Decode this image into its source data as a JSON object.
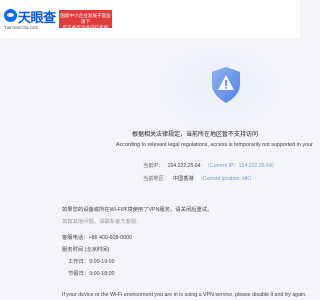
{
  "header": {
    "logo_text": "天眼查",
    "logo_domain": "TianYanCha.com",
    "promo_line_1": "国家中小企业发展子基金旗下",
    "promo_line_2": "官方备案企业征信机构"
  },
  "notice": {
    "title_zh": "根据相关法律规定，当前所在地区暂不支持访问",
    "title_en": "According to relevant legal regulations, access is temporarily not supported in your"
  },
  "ip": {
    "label": "当前IP：",
    "value": "154.222.25.64",
    "en": "（Current IP：154.222.25.64）"
  },
  "region": {
    "label": "当前地区：",
    "value": "中国香港",
    "en": "（Current location: HK）"
  },
  "contact": {
    "vpn_notice": "如果您的设备或所在Wi-Fi环境使用了VPN服务，请关闭后重试。",
    "help_prompt": "如有其他问题，请联系客方客服：",
    "phone_label": "客服电话：",
    "phone": "+86 400-608-0000",
    "hours_label": "服务时间 (北京时间)",
    "workday_label": "工作日：",
    "workday_hours": "9:00-19:00",
    "holiday_label": "节假日：",
    "holiday_hours": "9:00-18:00"
  },
  "footer_cut": "If your device or the Wi-Fi environment you are in is using a VPN service, please disable it and try again."
}
